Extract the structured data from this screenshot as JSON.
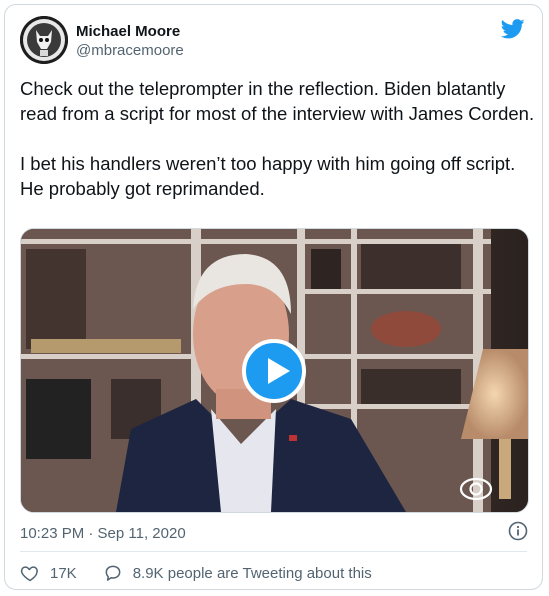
{
  "author": {
    "name": "Michael Moore",
    "handle": "@mbracemoore"
  },
  "tweet": {
    "paragraphs": [
      "Check out the teleprompter in the reflection. Biden blatantly read from a script for most of the interview with James Corden.",
      "I bet his handlers weren’t too happy with him going off script. He probably got reprimanded."
    ]
  },
  "media": {
    "type": "video",
    "watermark": "CBS-logo"
  },
  "meta": {
    "timestamp": "10:23 PM · Sep 11, 2020"
  },
  "actions": {
    "likes": "17K",
    "tweeting": "8.9K people are Tweeting about this"
  },
  "colors": {
    "brand_blue": "#1d9bf0",
    "text_secondary": "#536471"
  }
}
